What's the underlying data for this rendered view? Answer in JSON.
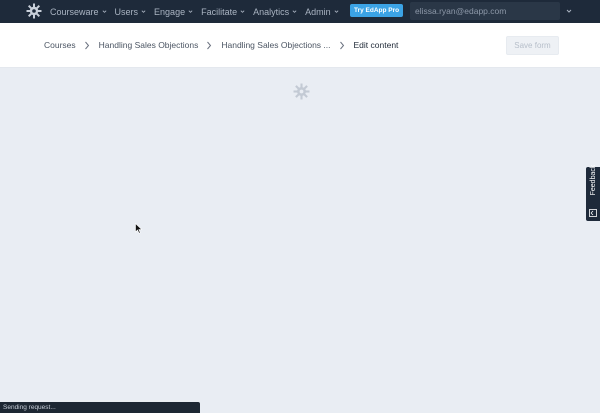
{
  "nav": {
    "items": [
      {
        "label": "Courseware"
      },
      {
        "label": "Users"
      },
      {
        "label": "Engage"
      },
      {
        "label": "Facilitate"
      },
      {
        "label": "Analytics"
      },
      {
        "label": "Admin"
      }
    ],
    "pro_button": "Try EdApp Pro",
    "user_email": "elissa.ryan@edapp.com"
  },
  "breadcrumb": {
    "items": [
      "Courses",
      "Handling Sales Objections",
      "Handling Sales Objections ..."
    ],
    "current": "Edit content"
  },
  "header": {
    "save_label": "Save form"
  },
  "feedback": {
    "label": "Feedback"
  },
  "status": {
    "text": "Sending request..."
  },
  "icons": {
    "logo": "gear-logo-icon",
    "spinner": "loading-gear-icon",
    "cursor": "mouse-pointer-icon",
    "feedback": "feedback-icon"
  },
  "colors": {
    "topbar": "#1e2a3a",
    "accent": "#3ba3e6",
    "page_background": "#e9edf3"
  }
}
